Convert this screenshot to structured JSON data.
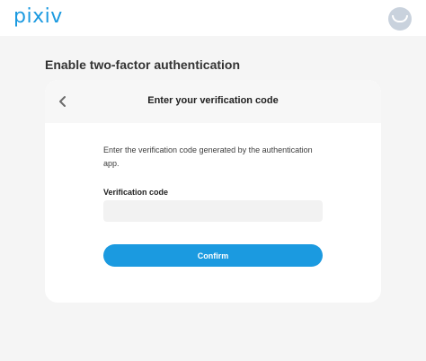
{
  "header": {
    "logo_text": "pixiv",
    "avatar_icon": "user-avatar-icon"
  },
  "page": {
    "title": "Enable two-factor authentication"
  },
  "card": {
    "back_icon": "chevron-left-icon",
    "title": "Enter your verification code",
    "description": "Enter the verification code generated by the authentication app.",
    "field_label": "Verification code",
    "field_value": "",
    "field_placeholder": "",
    "confirm_label": "Confirm"
  },
  "colors": {
    "brand": "#1b9ae0",
    "background": "#f5f5f5",
    "card": "#ffffff",
    "input_bg": "#f2f2f2"
  }
}
